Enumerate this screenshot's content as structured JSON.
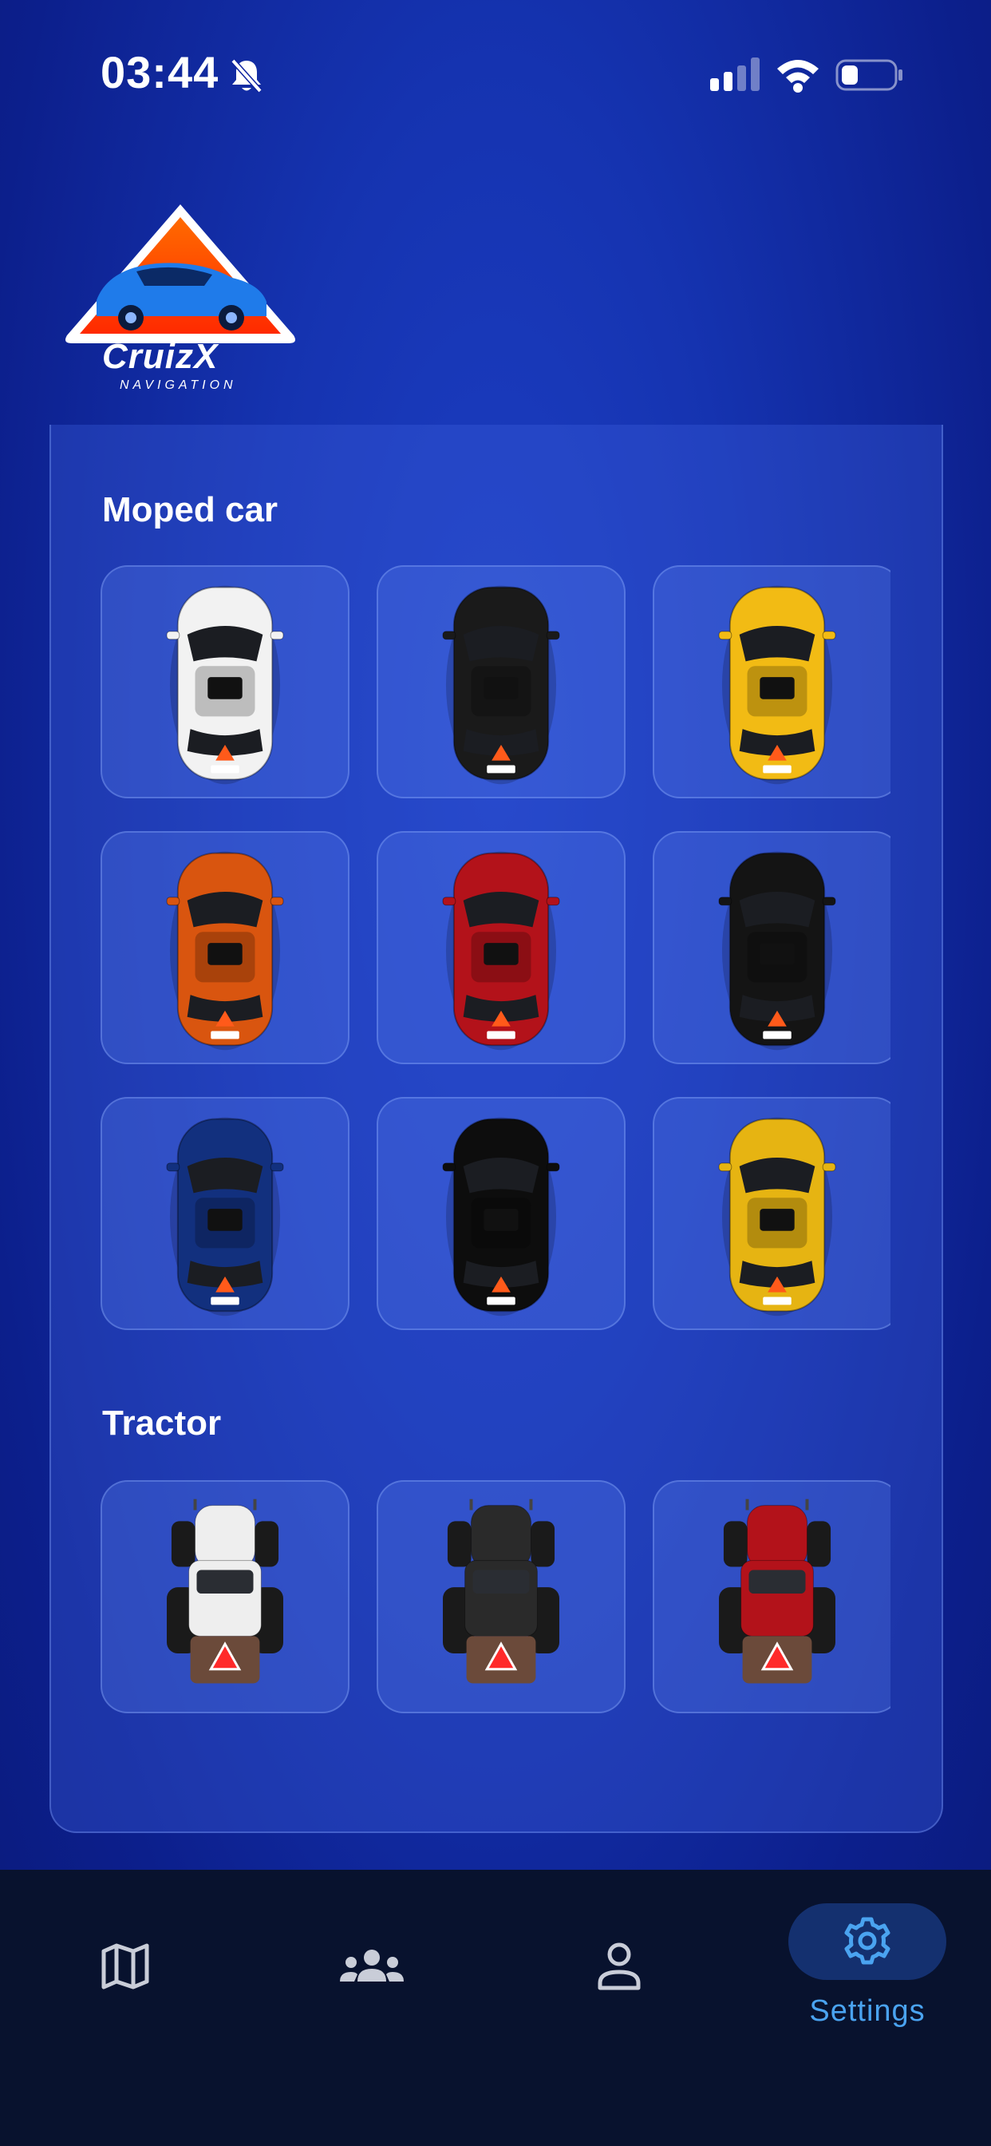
{
  "status_bar": {
    "time": "03:44",
    "battery_level": 0.2
  },
  "logo": {
    "brand": "CruizX",
    "tagline": "NAVIGATION"
  },
  "sections": [
    {
      "title": "Moped car",
      "vehicles": [
        {
          "type": "car",
          "color": "#f2f2f2",
          "label": "white-car"
        },
        {
          "type": "car",
          "color": "#1a1a1a",
          "label": "black-car"
        },
        {
          "type": "car",
          "color": "#f2bb14",
          "label": "yellow-car"
        },
        {
          "type": "car",
          "color": "#d9550f",
          "label": "orange-car"
        },
        {
          "type": "car",
          "color": "#b3121a",
          "label": "red-car"
        },
        {
          "type": "car",
          "color": "#141414",
          "label": "dark-car"
        },
        {
          "type": "car",
          "color": "#12307e",
          "label": "blue-car"
        },
        {
          "type": "car",
          "color": "#0d0d0d",
          "label": "black-car-2"
        },
        {
          "type": "car",
          "color": "#e6b412",
          "label": "yellow-car-2"
        }
      ]
    },
    {
      "title": "Tractor",
      "vehicles": [
        {
          "type": "tractor",
          "color": "#eeeeee",
          "label": "white-tractor"
        },
        {
          "type": "tractor",
          "color": "#2a2a2a",
          "label": "black-tractor"
        },
        {
          "type": "tractor",
          "color": "#b3121a",
          "label": "red-tractor"
        }
      ]
    }
  ],
  "nav": {
    "items": [
      {
        "icon": "map-icon",
        "label": ""
      },
      {
        "icon": "group-icon",
        "label": ""
      },
      {
        "icon": "person-icon",
        "label": ""
      },
      {
        "icon": "gear-icon",
        "label": "Settings",
        "active": true
      }
    ]
  },
  "colors": {
    "accent": "#4aa3f0",
    "nav_bg": "#08122e",
    "active_pill": "#14306f"
  }
}
